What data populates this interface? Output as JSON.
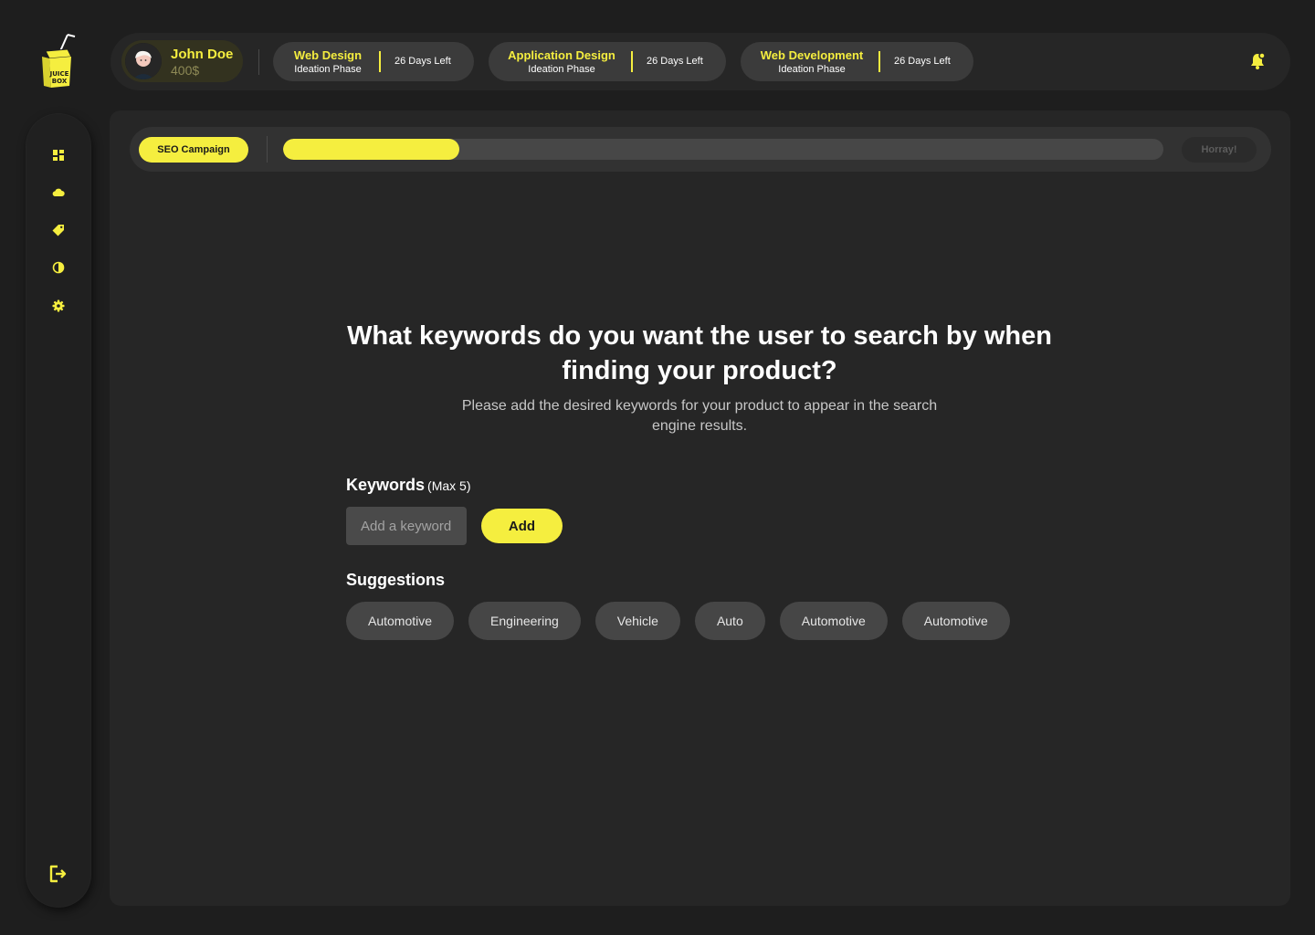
{
  "brand": {
    "logo_text": "JUICE BOX",
    "accent": "#f5ee3f"
  },
  "sidebar": {
    "items": [
      {
        "icon": "dashboard-icon"
      },
      {
        "icon": "cloud-icon"
      },
      {
        "icon": "tag-icon"
      },
      {
        "icon": "contrast-icon"
      },
      {
        "icon": "gear-icon"
      }
    ],
    "logout_icon": "logout-icon"
  },
  "user": {
    "name": "John Doe",
    "balance": "400$"
  },
  "projects": [
    {
      "title": "Web Design",
      "phase": "Ideation Phase",
      "days_left": "26 Days Left"
    },
    {
      "title": "Application Design",
      "phase": "Ideation Phase",
      "days_left": "26 Days Left"
    },
    {
      "title": "Web Development",
      "phase": "Ideation Phase",
      "days_left": "26 Days Left"
    }
  ],
  "campaign": {
    "label": "SEO Campaign",
    "progress": 0.2,
    "end_label": "Horray!"
  },
  "question": {
    "heading": "What keywords do you want the user to search by when finding your product?",
    "subheading": "Please add the desired keywords for your product to appear in the search engine results."
  },
  "keywords": {
    "label": "Keywords",
    "max_note": "(Max 5)",
    "input_placeholder": "Add a keyword",
    "input_value": "",
    "add_label": "Add"
  },
  "suggestions": {
    "label": "Suggestions",
    "items": [
      "Automotive",
      "Engineering",
      "Vehicle",
      "Auto",
      "Automotive",
      "Automotive"
    ]
  }
}
